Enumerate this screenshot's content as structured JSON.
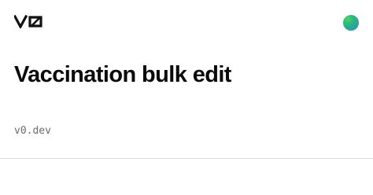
{
  "brand": {
    "logo_text": "v0",
    "avatar_colors": [
      "#4fd36a",
      "#2fb67a",
      "#1f8fd0"
    ]
  },
  "main": {
    "title": "Vaccination bulk edit",
    "url": "v0.dev"
  },
  "colors": {
    "background": "#ffffff",
    "title": "#0a0a0a",
    "url": "#6b6b6b",
    "divider": "#dcdcdc"
  }
}
